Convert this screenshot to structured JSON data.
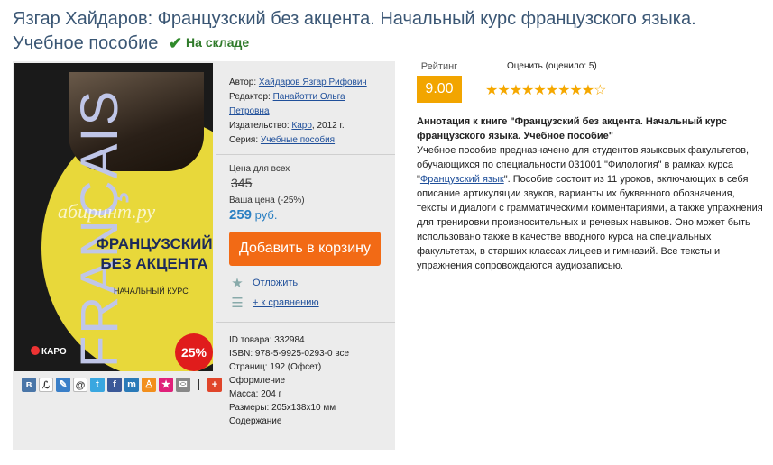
{
  "title": "Язгар Хайдаров: Французский без акцента. Начальный курс французского языка. Учебное пособие",
  "stock_status": "На складе",
  "cover": {
    "vertical_text": "FRANÇAIS",
    "watermark": "абиринт.ру",
    "title": "ФРАНЦУЗСКИЙ БЕЗ АКЦЕНТА",
    "subtitle": "НАЧАЛЬНЫЙ КУРС",
    "publisher_logo": "КАРО",
    "discount_badge": "25%"
  },
  "meta": {
    "author_label": "Автор:",
    "author": "Хайдаров Язгар Рифович",
    "editor_label": "Редактор:",
    "editor": "Панайотти Ольга Петровна",
    "publisher_label": "Издательство:",
    "publisher": "Каро",
    "year": ", 2012 г.",
    "series_label": "Серия:",
    "series": "Учебные пособия"
  },
  "price": {
    "all_label": "Цена для всех",
    "old_price": "345",
    "your_label": "Ваша цена (-25%)",
    "new_price": "259",
    "currency": " руб.",
    "cart_button": "Добавить в корзину",
    "postpone": "Отложить",
    "compare": "+ к сравнению"
  },
  "details": {
    "id_label": "ID товара: 332984",
    "isbn": "ISBN: 978-5-9925-0293-0",
    "isbn_all": "все",
    "pages": "Страниц: 192 (Офсет)",
    "design": "Оформление",
    "weight": "Масса: 204 г",
    "size": "Размеры: 205х138х10 мм",
    "contents": "Содержание"
  },
  "rating": {
    "label": "Рейтинг",
    "score": "9.00",
    "evaluate": "Оценить (оценило: 5)",
    "stars_full": 9,
    "stars_total": 10
  },
  "annotation": {
    "heading": "Аннотация к книге \"Французский без акцента. Начальный курс французского языка. Учебное пособие\"",
    "text_part1": "Учебное пособие предназначено для студентов языковых факультетов, обучающихся по специальности 031001 \"Филология\" в рамках курса \"",
    "link": "Французский язык",
    "text_part2": "\". Пособие состоит из 11 уроков, включающих в себя описание артикуляции звуков, варианты их буквенного обозначения, тексты и диалоги с грамматическими комментариями, а также упражнения для тренировки произносительных и речевых навыков. Оно может быть использовано также в качестве вводного курса на специальных факультетах, в старших классах лицеев и гимназий. Все тексты и упражнения сопровождаются аудиозаписью."
  },
  "share_icons": [
    {
      "name": "vk-share-icon",
      "glyph": "в",
      "color": "#4a76a8"
    },
    {
      "name": "lj-share-icon",
      "glyph": "ℒ",
      "color": "#ffffff"
    },
    {
      "name": "liveinternet-share-icon",
      "glyph": "✎",
      "color": "#3a7fc8"
    },
    {
      "name": "mailru-share-icon",
      "glyph": "@",
      "color": "#ffffff"
    },
    {
      "name": "twitter-share-icon",
      "glyph": "t",
      "color": "#3aa7e0"
    },
    {
      "name": "facebook-share-icon",
      "glyph": "f",
      "color": "#3b5998"
    },
    {
      "name": "moimir-share-icon",
      "glyph": "m",
      "color": "#2a7ab8"
    },
    {
      "name": "odnoklassniki-share-icon",
      "glyph": "♙",
      "color": "#f28f1c"
    },
    {
      "name": "bookmark-share-icon",
      "glyph": "★",
      "color": "#e0207a"
    },
    {
      "name": "email-share-icon",
      "glyph": "✉",
      "color": "#888888"
    },
    {
      "name": "more-share-icon",
      "glyph": "+",
      "color": "#e0452a"
    }
  ]
}
